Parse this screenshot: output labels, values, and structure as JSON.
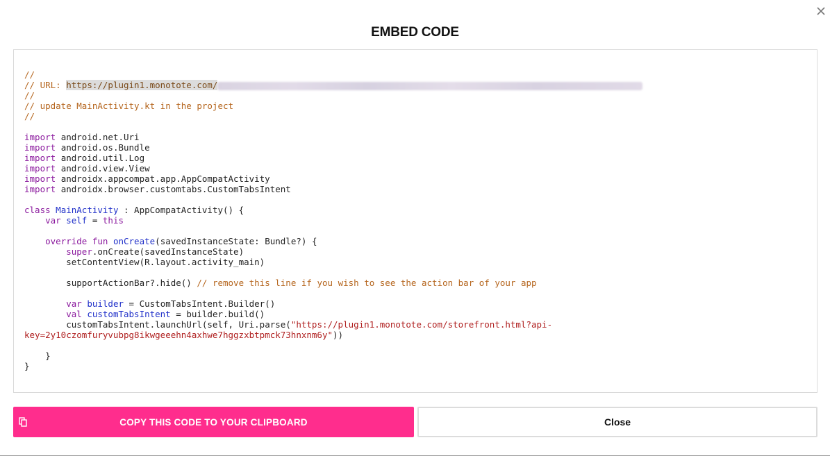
{
  "modal": {
    "title": "EMBED CODE",
    "close_icon": "close-icon"
  },
  "code": {
    "url_prefix": "// URL: ",
    "url_text": "https://plugin1.monotote.com/",
    "comment_update": "// update MainActivity.kt in the project",
    "comment_slashes": "//",
    "imports": [
      "android.net.Uri",
      "android.os.Bundle",
      "android.util.Log",
      "android.view.View",
      "androidx.appcompat.app.AppCompatActivity",
      "androidx.browser.customtabs.CustomTabsIntent"
    ],
    "import_keyword": "import",
    "class_keyword": "class",
    "class_name": "MainActivity",
    "class_extends": " : AppCompatActivity() {",
    "var_keyword": "var",
    "val_keyword": "val",
    "self_name": "self",
    "self_assign": " = ",
    "this_keyword": "this",
    "override_fun": "override fun",
    "on_create": "onCreate",
    "on_create_params": "(savedInstanceState: Bundle?) {",
    "super_keyword": "super",
    "super_call": ".onCreate(savedInstanceState)",
    "set_content": "setContentView(R.layout.activity_main)",
    "support_action": "supportActionBar?.hide() ",
    "support_comment": "// remove this line if you wish to see the action bar of your app",
    "builder_name": "builder",
    "builder_value": " = CustomTabsIntent.Builder()",
    "custom_tabs_name": "customTabsIntent",
    "custom_tabs_value": " = builder.build()",
    "launch_prefix": "customTabsIntent.launchUrl(self, Uri.parse(",
    "launch_string_1": "\"https://plugin1.monotote.com/storefront.html?api-",
    "launch_string_2": "key=2y10czomfuryvubpg8ikwgeeehn4axhwe7hggzxbtpmck73hnxnm6y\"",
    "launch_suffix": "))",
    "close_brace_inner": "}",
    "close_brace_outer": "}"
  },
  "buttons": {
    "copy_label": "COPY THIS CODE TO YOUR CLIPBOARD",
    "copy_icon": "copy-icon",
    "close_label": "Close"
  },
  "colors": {
    "accent": "#ff2d8d",
    "comment": "#b5651d",
    "keyword": "#8b1a9e",
    "type": "#1f2fc9",
    "string": "#b02020"
  }
}
